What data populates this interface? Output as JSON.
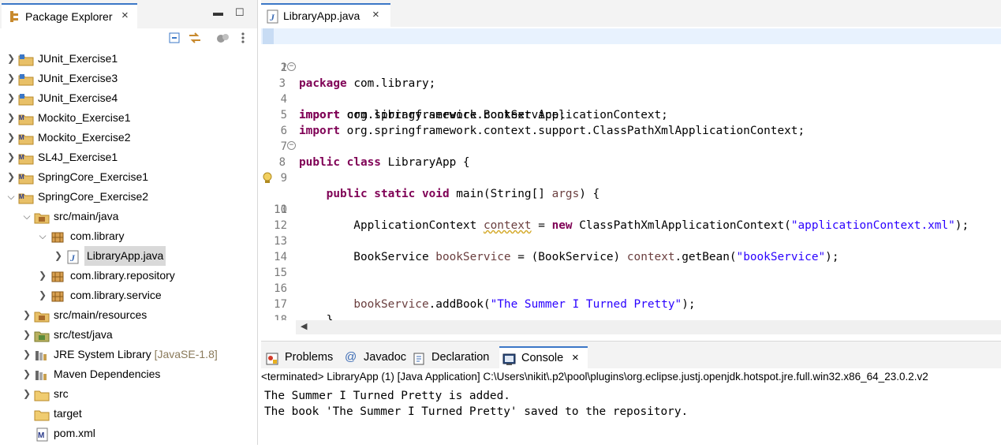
{
  "package_explorer": {
    "title": "Package Explorer",
    "close": "×",
    "minimize": "▬",
    "maximize": "☐",
    "tree": [
      {
        "label": "JUnit_Exercise1",
        "expanded": false
      },
      {
        "label": "JUnit_Exercise3",
        "expanded": false
      },
      {
        "label": "JUnit_Exercise4",
        "expanded": false
      },
      {
        "label": "Mockito_Exercise1",
        "expanded": false
      },
      {
        "label": "Mockito_Exercise2",
        "expanded": false
      },
      {
        "label": "SL4J_Exercise1",
        "expanded": false
      },
      {
        "label": "SpringCore_Exercise1",
        "expanded": false
      },
      {
        "label": "SpringCore_Exercise2",
        "expanded": true
      },
      {
        "label": "src/main/java",
        "expanded": true
      },
      {
        "label": "com.library",
        "expanded": true
      },
      {
        "label": "LibraryApp.java",
        "expanded": false,
        "selected": true
      },
      {
        "label": "com.library.repository",
        "expanded": false
      },
      {
        "label": "com.library.service",
        "expanded": false
      },
      {
        "label": "src/main/resources",
        "expanded": false
      },
      {
        "label": "src/test/java",
        "expanded": false
      },
      {
        "label": "JRE System Library",
        "decoration": "[JavaSE-1.8]",
        "expanded": false
      },
      {
        "label": "Maven Dependencies",
        "expanded": false
      },
      {
        "label": "src",
        "expanded": false
      },
      {
        "label": "target"
      },
      {
        "label": "pom.xml"
      }
    ]
  },
  "editor": {
    "tab_label": "LibraryApp.java",
    "tab_close": "×",
    "line_numbers": [
      "1",
      "2",
      "3",
      "4",
      "5",
      "6",
      "7",
      "8",
      "9",
      "10",
      "11",
      "12",
      "13",
      "14",
      "15",
      "16",
      "17",
      "18",
      "19"
    ],
    "code": {
      "l1_kw": "package",
      "l1_rest": " com.library;",
      "l3_kw": "import",
      "l3_rest": " com.library.service.BookService;",
      "l4_kw": "import",
      "l4_rest": " org.springframework.context.ApplicationContext;",
      "l5_kw": "import",
      "l5_rest": " org.springframework.context.support.ClassPathXmlApplicationContext;",
      "l7_kw": "public class",
      "l7_rest": " LibraryApp {",
      "l8_indent": "    ",
      "l8_kw": "public static void",
      "l8_rest": " main(String[] ",
      "l8_var": "args",
      "l8_end": ") {",
      "l10_a": "        ApplicationContext ",
      "l10_var": "context",
      "l10_b": " = ",
      "l10_kw": "new",
      "l10_c": " ClassPathXmlApplicationContext(",
      "l10_str": "\"applicationContext.xml\"",
      "l10_d": ");",
      "l13_a": "        BookService ",
      "l13_var": "bookService",
      "l13_b": " = (BookService) ",
      "l13_var2": "context",
      "l13_c": ".getBean(",
      "l13_str": "\"bookService\"",
      "l13_d": ");",
      "l16_a": "        ",
      "l16_var": "bookService",
      "l16_b": ".addBook(",
      "l16_str": "\"The Summer I Turned Pretty\"",
      "l16_c": ");",
      "l17": "    }",
      "l18": "}"
    }
  },
  "bottom_panel": {
    "tabs": [
      "Problems",
      "Javadoc",
      "Declaration",
      "Console"
    ],
    "console_close": "×",
    "terminated": "<terminated> LibraryApp (1) [Java Application] C:\\Users\\nikit\\.p2\\pool\\plugins\\org.eclipse.justj.openjdk.hotspot.jre.full.win32.x86_64_23.0.2.v2",
    "output": [
      "The Summer I Turned Pretty is added.",
      "The book 'The Summer I Turned Pretty' saved to the repository."
    ]
  }
}
